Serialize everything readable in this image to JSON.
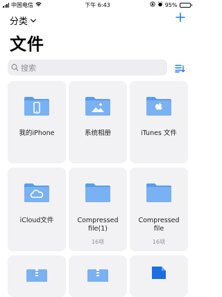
{
  "status_bar": {
    "carrier": "中国电信",
    "time": "下午 6:43",
    "battery_percent": "95%",
    "battery_level": 0.95
  },
  "nav": {
    "browse_label": "分类",
    "add_icon": "plus-icon"
  },
  "page": {
    "title": "文件"
  },
  "search": {
    "placeholder": "搜索"
  },
  "colors": {
    "accent": "#1a7cf6",
    "folder": "#79b1f3",
    "folder_dark": "#5a9bef",
    "card_bg": "#f2f2f4"
  },
  "items": [
    {
      "name": "我的iPhone",
      "count": "",
      "icon": "iphone-folder-icon"
    },
    {
      "name": "系统相册",
      "count": "",
      "icon": "photos-folder-icon"
    },
    {
      "name": "iTunes 文件",
      "count": "",
      "icon": "apple-folder-icon"
    },
    {
      "name": "iCloud文件",
      "count": "",
      "icon": "icloud-folder-icon"
    },
    {
      "name": "Compressed file(1)",
      "count": "16项",
      "icon": "folder-icon"
    },
    {
      "name": "Compressed file",
      "count": "16项",
      "icon": "folder-icon"
    },
    {
      "name": "",
      "count": "",
      "icon": "zip-file-icon"
    },
    {
      "name": "",
      "count": "",
      "icon": "zip-file-icon"
    },
    {
      "name": "",
      "count": "",
      "icon": "document-icon"
    }
  ]
}
